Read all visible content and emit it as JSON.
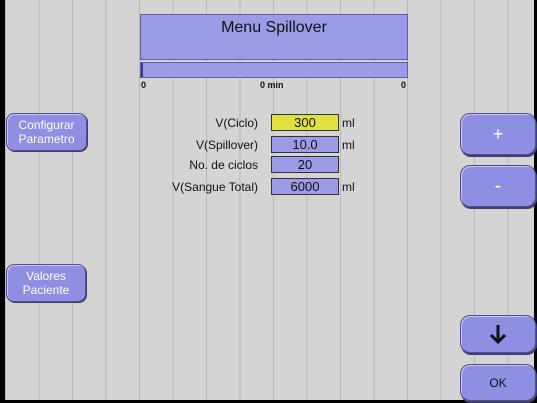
{
  "title": "Menu Spillover",
  "progress": {
    "fraction": 0,
    "left_label": "0",
    "center_label": "0 min",
    "right_label": "0"
  },
  "left_buttons": {
    "configurar": "Configurar\nParametro",
    "valores": "Valores\nPaciente"
  },
  "params": [
    {
      "label": "V(Ciclo)",
      "value": "300",
      "unit": "ml",
      "active": true
    },
    {
      "label": "V(Spillover)",
      "value": "10.0",
      "unit": "ml",
      "active": false
    },
    {
      "label": "No. de ciclos",
      "value": "20",
      "unit": "",
      "active": false
    },
    {
      "label": "V(Sangue Total)",
      "value": "6000",
      "unit": "ml",
      "active": false
    }
  ],
  "right_buttons": {
    "plus": "+",
    "minus": "-",
    "down_icon": "arrow-down-icon",
    "ok": "OK"
  },
  "colors": {
    "background": "#d4d4d4",
    "panel": "#9c9ce6",
    "button": "#8e8ee2",
    "active_field": "#e0e040"
  }
}
